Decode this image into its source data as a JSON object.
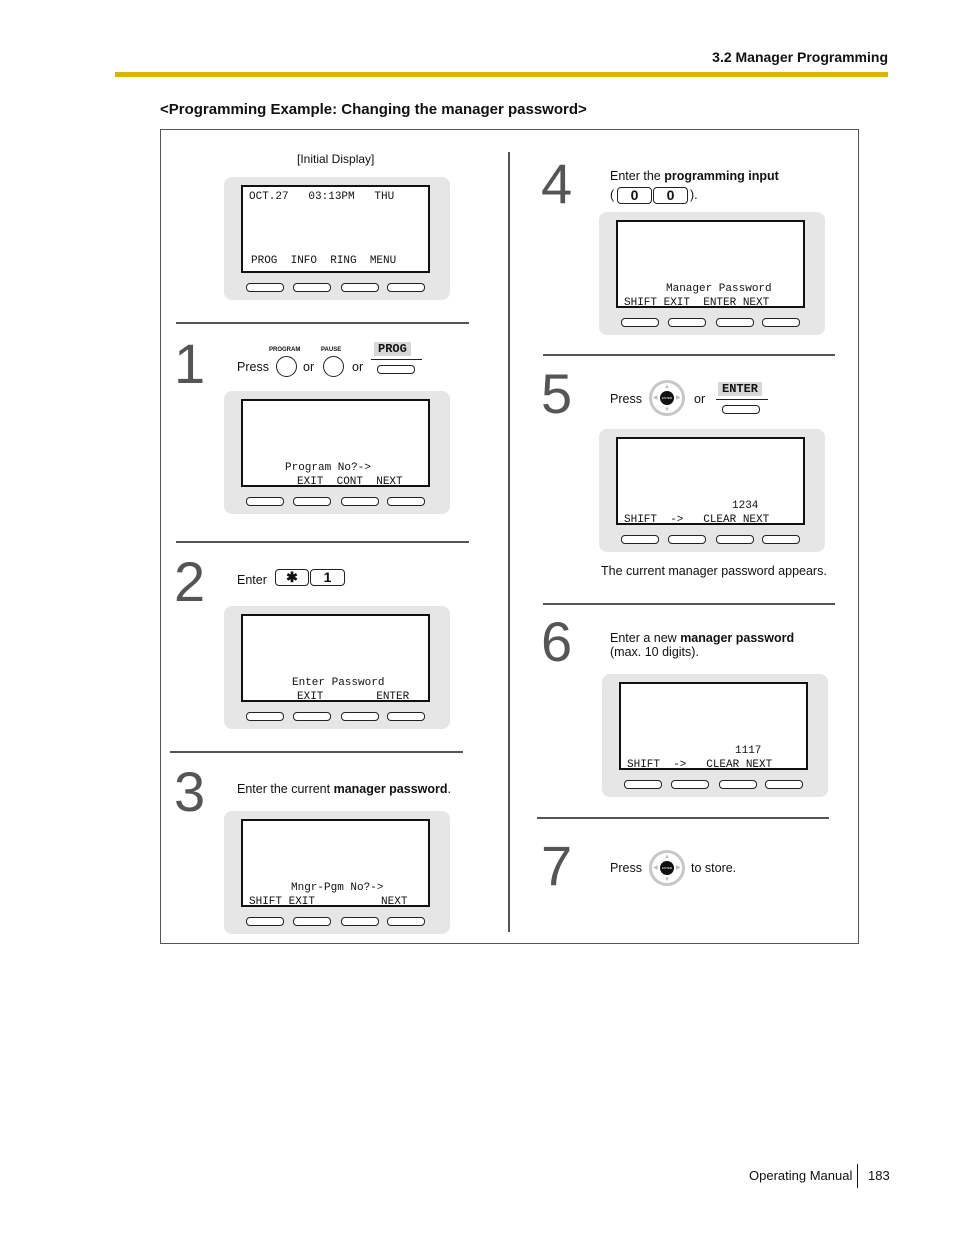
{
  "header": {
    "section": "3.2 Manager Programming",
    "accent_color": "#d9b400"
  },
  "title": "<Programming Example: Changing the manager password>",
  "initial": {
    "caption": "[Initial Display]",
    "lcd": {
      "line1": "OCT.27   03:13PM   THU",
      "line2": "",
      "softkeys": "PROG  INFO  RING  MENU"
    }
  },
  "steps": [
    {
      "num": "1",
      "press": "Press",
      "or1": "or",
      "or2": "or",
      "btn1_label": "PROGRAM",
      "btn2_label": "PAUSE",
      "softkey": "PROG",
      "lcd": {
        "line1": "Program No?->",
        "softkeys": "EXIT  CONT  NEXT"
      }
    },
    {
      "num": "2",
      "text": "Enter",
      "keys": [
        "✱",
        "1"
      ],
      "lcd": {
        "line1": "Enter Password",
        "softkeys": "EXIT        ENTER"
      }
    },
    {
      "num": "3",
      "text_pre": "Enter the current ",
      "text_bold": "manager  password",
      "text_post": ".",
      "lcd": {
        "line1": "Mngr-Pgm No?->",
        "softkeys": "SHIFT EXIT          NEXT"
      }
    },
    {
      "num": "4",
      "text_pre": "Enter the ",
      "text_bold": "programming input",
      "open": "(",
      "close": ").",
      "keys": [
        "0",
        "0"
      ],
      "lcd": {
        "line1": "Manager Password",
        "softkeys": "SHIFT EXIT  ENTER NEXT"
      }
    },
    {
      "num": "5",
      "press": "Press",
      "or": "or",
      "navkey": "ENTER",
      "softkey": "ENTER",
      "lcd": {
        "line1": "1234",
        "softkeys": "SHIFT  ->   CLEAR NEXT"
      },
      "note": "The current manager password appears."
    },
    {
      "num": "6",
      "text_pre": "Enter a new ",
      "text_bold": "manager password",
      "text_line2": "(max. 10 digits).",
      "lcd": {
        "line1": "1117",
        "softkeys": "SHIFT  ->   CLEAR NEXT"
      }
    },
    {
      "num": "7",
      "press": "Press",
      "navkey": "ENTER",
      "text_post": "to store."
    }
  ],
  "footer": {
    "manual": "Operating Manual",
    "page": "183"
  }
}
